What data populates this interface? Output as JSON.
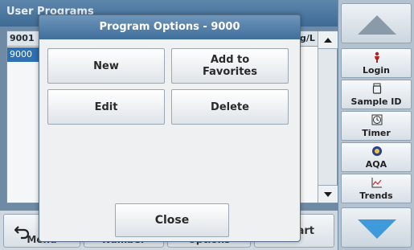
{
  "window": {
    "title": "User Programs"
  },
  "list": {
    "header": {
      "col1": "9001",
      "col2": "g/L"
    },
    "selected_row": "9000"
  },
  "bottom_bar": {
    "items": [
      {
        "label": "Menu"
      },
      {
        "label": "Number"
      },
      {
        "label": "Options"
      },
      {
        "label": "Start"
      }
    ]
  },
  "sidebar": {
    "items": [
      {
        "label": "Login",
        "icon": "person-icon"
      },
      {
        "label": "Sample ID",
        "icon": "sample-bottle-icon"
      },
      {
        "label": "Timer",
        "icon": "timer-icon"
      },
      {
        "label": "AQA",
        "icon": "aqa-icon"
      },
      {
        "label": "Trends",
        "icon": "trends-chart-icon"
      }
    ]
  },
  "dialog": {
    "title": "Program Options - 9000",
    "buttons": {
      "new": "New",
      "add_favorites": "Add to Favorites",
      "edit": "Edit",
      "delete": "Delete",
      "close": "Close"
    }
  },
  "colors": {
    "title_blue": "#3f6f9c",
    "selected_row": "#2f6fb3",
    "dialog_bg": "#eef0f2",
    "sidebar_bg": "#b4c2cf"
  }
}
